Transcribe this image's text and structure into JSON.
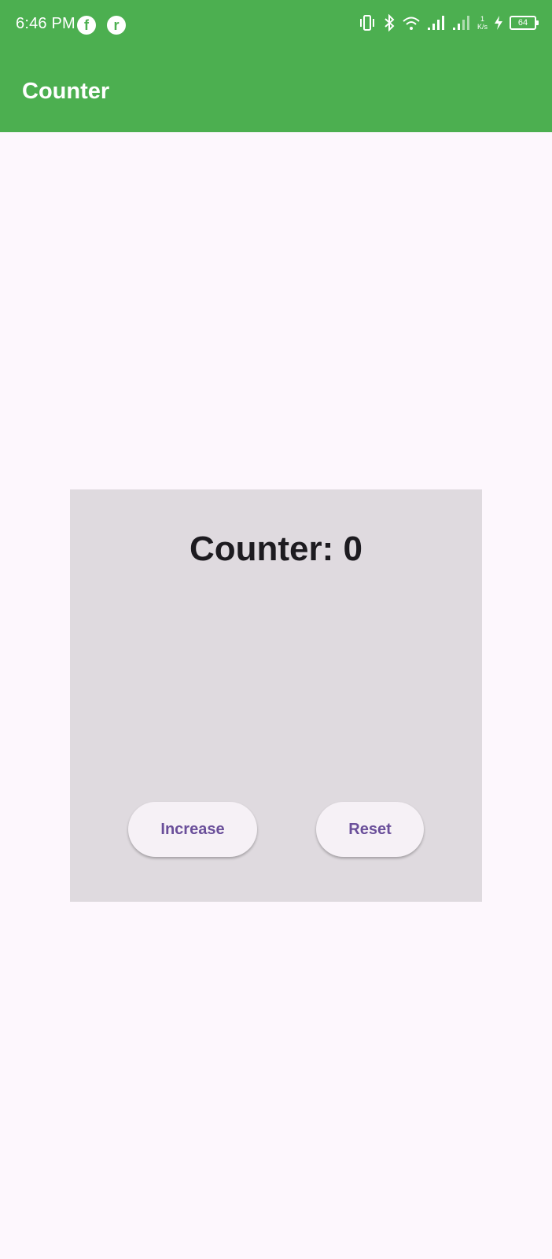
{
  "status_bar": {
    "time": "6:46 PM",
    "net_speed_value": "1",
    "net_speed_unit": "K/s",
    "battery": "64",
    "icons": [
      "facebook-icon",
      "app-icon",
      "vibrate-icon",
      "bluetooth-icon",
      "wifi-icon",
      "signal-icon",
      "signal-icon",
      "charging-icon",
      "battery-icon"
    ]
  },
  "app_bar": {
    "title": "Counter",
    "color": "#4caf50"
  },
  "card": {
    "counter_text": "Counter: 0",
    "increase_label": "Increase",
    "reset_label": "Reset",
    "background": "#dfdadf",
    "button_text_color": "#6a4f9a"
  }
}
